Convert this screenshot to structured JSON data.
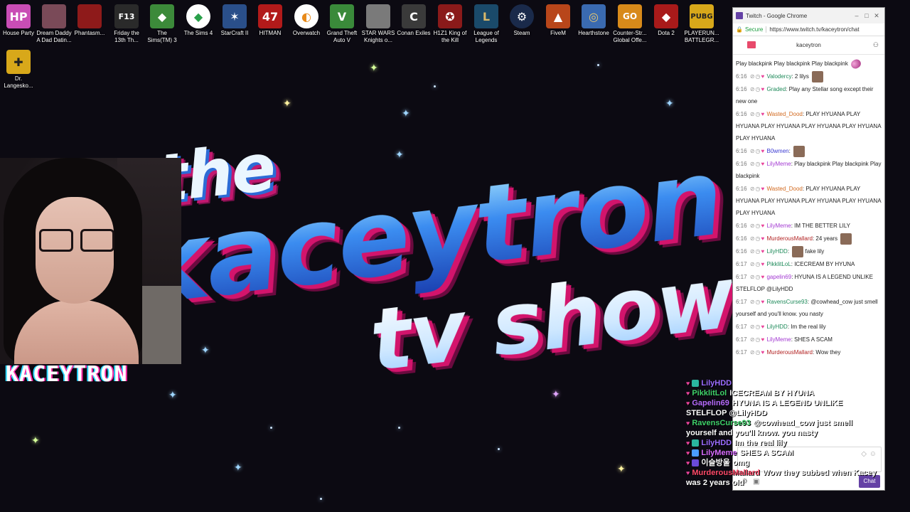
{
  "desktop": {
    "icons": [
      {
        "label": "House Party",
        "label2": "",
        "badge": "HP",
        "color": "#c94db5"
      },
      {
        "label": "Dream Daddy",
        "label2": "A Dad Datin...",
        "badge": "",
        "color": "#7a4a58"
      },
      {
        "label": "Phantasm...",
        "label2": "",
        "badge": "",
        "color": "#8e1a1a"
      },
      {
        "label": "Friday the",
        "label2": "13th Th...",
        "badge": "F13",
        "color": "#2a2a2a"
      },
      {
        "label": "The",
        "label2": "Sims(TM) 3",
        "badge": "",
        "color": "#3c8a3a"
      },
      {
        "label": "The Sims 4",
        "label2": "",
        "badge": "",
        "color": "#2aa04a"
      },
      {
        "label": "StarCraft II",
        "label2": "",
        "badge": "",
        "color": "#2a4f8a"
      },
      {
        "label": "HITMAN",
        "label2": "",
        "badge": "47",
        "color": "#b21a1a"
      },
      {
        "label": "Overwatch",
        "label2": "",
        "badge": "",
        "color": "#e88a1a"
      },
      {
        "label": "Grand Theft",
        "label2": "Auto V",
        "badge": "",
        "color": "#3a8a3a"
      },
      {
        "label": "STAR WARS",
        "label2": "Knights o...",
        "badge": "",
        "color": "#7a7a7a"
      },
      {
        "label": "Conan Exiles",
        "label2": "",
        "badge": "",
        "color": "#3a3a3a"
      },
      {
        "label": "H1Z1 King of",
        "label2": "the Kill",
        "badge": "",
        "color": "#8a1a1a"
      },
      {
        "label": "League of",
        "label2": "Legends",
        "badge": "",
        "color": "#1a4a6a"
      },
      {
        "label": "Steam",
        "label2": "",
        "badge": "",
        "color": "#1a2a4a"
      },
      {
        "label": "FiveM",
        "label2": "",
        "badge": "",
        "color": "#b8461a"
      },
      {
        "label": "Hearthstone",
        "label2": "",
        "badge": "",
        "color": "#3a6ab0"
      },
      {
        "label": "Counter-Str...",
        "label2": "Global Offe...",
        "badge": "GO",
        "color": "#d88a1a"
      },
      {
        "label": "Dota 2",
        "label2": "",
        "badge": "",
        "color": "#a81a1a"
      },
      {
        "label": "PLAYERUN...",
        "label2": "BATTLEGR...",
        "badge": "PUBG",
        "color": "#d8a81a"
      },
      {
        "label": "Dr.",
        "label2": "Langesko...",
        "badge": "",
        "color": "#d8a81a"
      }
    ]
  },
  "logo": {
    "the": "the",
    "kt": "kaceytron",
    "tv": "tv show"
  },
  "webcam": {
    "name": "KACEYTRON"
  },
  "browser": {
    "title": "Twitch - Google Chrome",
    "secure_label": "Secure",
    "url": "https://www.twitch.tv/kaceytron/chat",
    "channel": "kaceytron",
    "chat_placeholder": "",
    "send_label": "Chat",
    "messages": [
      {
        "ts": "",
        "user": "",
        "color": "#333",
        "text": "Play blackpink  Play blackpink  Play blackpink"
      },
      {
        "ts": "6:16",
        "user": "Valodercy",
        "color": "#1e8a5a",
        "text": "2 lilys"
      },
      {
        "ts": "6:16",
        "user": "Graded",
        "color": "#1e8a5a",
        "text": "Play any Stellar song except their new one"
      },
      {
        "ts": "6:16",
        "user": "Wasted_Dood",
        "color": "#d2691e",
        "text": "PLAY HYUANA  PLAY HYUANA  PLAY HYUANA  PLAY HYUANA  PLAY HYUANA  PLAY HYUANA"
      },
      {
        "ts": "6:16",
        "user": "B0wmen",
        "color": "#3a3ad2",
        "text": ""
      },
      {
        "ts": "6:16",
        "user": "LilyMeme",
        "color": "#a33ad2",
        "text": "Play blackpink  Play blackpink  Play blackpink"
      },
      {
        "ts": "6:16",
        "user": "Wasted_Dood",
        "color": "#d2691e",
        "text": "PLAY HYUANA  PLAY HYUANA  PLAY HYUANA  PLAY HYUANA  PLAY HYUANA  PLAY HYUANA"
      },
      {
        "ts": "6:16",
        "user": "LilyMeme",
        "color": "#a33ad2",
        "text": "IM THE BETTER LILY"
      },
      {
        "ts": "6:16",
        "user": "MurderousMallard",
        "color": "#b22222",
        "text": "24 years"
      },
      {
        "ts": "6:16",
        "user": "LilyHDD",
        "color": "#1e8a5a",
        "text": "fake lily"
      },
      {
        "ts": "6:17",
        "user": "PikklitLoL",
        "color": "#1e8a5a",
        "text": "ICECREAM BY HYUNA"
      },
      {
        "ts": "6:17",
        "user": "gapelin69",
        "color": "#a33ad2",
        "text": "HYUNA IS A LEGEND UNLIKE STELFLOP @LilyHDD"
      },
      {
        "ts": "6:17",
        "user": "RavensCurse93",
        "color": "#1e8a5a",
        "text": "@cowhead_cow just smell yourself and you'll know. you nasty"
      },
      {
        "ts": "6:17",
        "user": "LilyHDD",
        "color": "#1e8a5a",
        "text": "Im the real lily"
      },
      {
        "ts": "6:17",
        "user": "LilyMeme",
        "color": "#a33ad2",
        "text": "SHES A SCAM"
      },
      {
        "ts": "6:17",
        "user": "MurderousMallard",
        "color": "#b22222",
        "text": "Wow they"
      }
    ]
  },
  "overlay": {
    "lines": [
      {
        "user": "LilyHDD",
        "color": "#9b6cff",
        "msg": ""
      },
      {
        "user": "PikklitLol",
        "color": "#3fd16a",
        "msg": "ICECREAM BY HYUNA"
      },
      {
        "user": "Gapelin69",
        "color": "#b76cff",
        "msg": "HYUNA IS A LEGEND UNLIKE"
      },
      {
        "user": "",
        "color": "#ffffff",
        "msg": "STELFLOP @LilyHDD"
      },
      {
        "user": "RavensCurse93",
        "color": "#3fd16a",
        "msg": "@cowhead_cow just smell"
      },
      {
        "user": "",
        "color": "#ffffff",
        "msg": "yourself and you'll know. you nasty"
      },
      {
        "user": "LilyHDD",
        "color": "#9b6cff",
        "msg": "Im the real lily"
      },
      {
        "user": "LilyMeme",
        "color": "#d86cff",
        "msg": "SHES A SCAM"
      },
      {
        "user": "이슬방울",
        "color": "#ffffff",
        "msg": "omg"
      },
      {
        "user": "MurderousMallard",
        "color": "#ff4a6a",
        "msg": "Wow they subbed when Kacey"
      },
      {
        "user": "",
        "color": "#ffffff",
        "msg": "was 2 years old"
      }
    ]
  }
}
